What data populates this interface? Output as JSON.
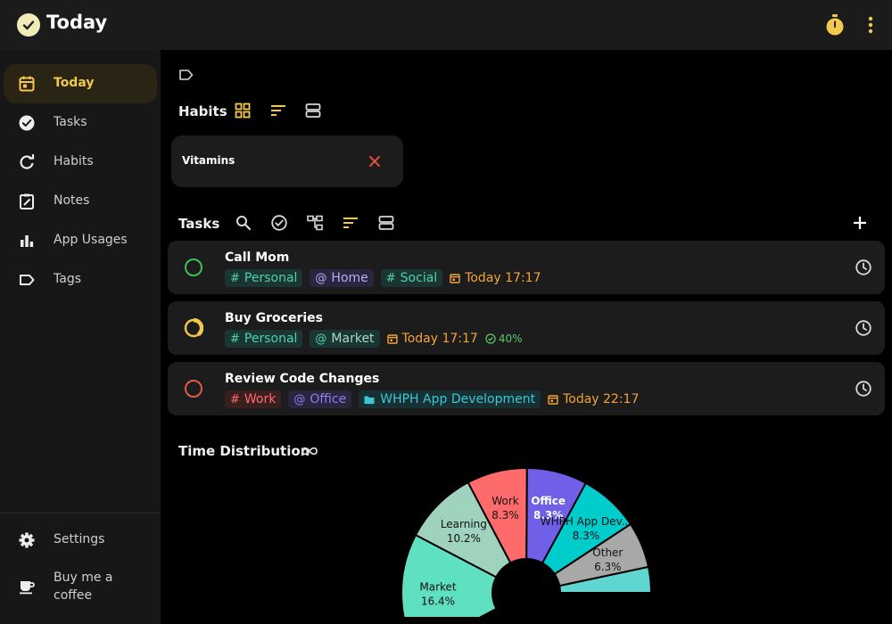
{
  "header": {
    "title": "Today",
    "app_icon": "check-circle-icon",
    "timer_icon": "stopwatch-icon",
    "menu_icon": "more-vert-icon"
  },
  "sidebar": {
    "items": [
      {
        "label": "Today",
        "icon": "calendar-icon",
        "active": true
      },
      {
        "label": "Tasks",
        "icon": "check-circle-icon"
      },
      {
        "label": "Habits",
        "icon": "refresh-icon"
      },
      {
        "label": "Notes",
        "icon": "note-edit-icon"
      },
      {
        "label": "App Usages",
        "icon": "bar-chart-icon"
      },
      {
        "label": "Tags",
        "icon": "label-icon"
      }
    ],
    "bottom": [
      {
        "label": "Settings",
        "icon": "gear-icon"
      },
      {
        "label": "Buy me a coffee",
        "icon": "coffee-cup-icon"
      }
    ]
  },
  "habits": {
    "title": "Habits",
    "items": [
      {
        "name": "Vitamins"
      }
    ]
  },
  "tasks": {
    "title": "Tasks",
    "items": [
      {
        "title": "Call Mom",
        "status": "empty",
        "status_color": "#3fbf5a",
        "chips": [
          {
            "prefix": "#",
            "text": "Personal",
            "style": "teal"
          },
          {
            "prefix": "@",
            "text": "Home",
            "style": "purple"
          },
          {
            "prefix": "#",
            "text": "Social",
            "style": "teal"
          }
        ],
        "date": "Today 17:17"
      },
      {
        "title": "Buy Groceries",
        "status": "in-progress",
        "status_color": "#f2c94c",
        "progress_fraction": 0.4,
        "chips": [
          {
            "prefix": "#",
            "text": "Personal",
            "style": "teal"
          },
          {
            "prefix": "@",
            "text": "Market",
            "style": "teal"
          }
        ],
        "date": "Today 17:17",
        "progress": "40%"
      },
      {
        "title": "Review Code Changes",
        "status": "empty",
        "status_color": "#e05a4f",
        "chips": [
          {
            "prefix": "#",
            "text": "Work",
            "style": "red"
          },
          {
            "prefix": "@",
            "text": "Office",
            "style": "purple"
          },
          {
            "prefix": "folder",
            "text": "WHPH App Development",
            "style": "cyan"
          }
        ],
        "date": "Today 22:17"
      }
    ]
  },
  "time_distribution": {
    "title": "Time Distribution",
    "icon": "infinity-icon"
  },
  "chart_data": {
    "type": "pie",
    "variant": "donut",
    "slices": [
      {
        "label": "Market",
        "value": 16.4,
        "value_label": "16.4%",
        "color": "#5fe0c0"
      },
      {
        "label": "Learning",
        "value": 10.2,
        "value_label": "10.2%",
        "color": "#9fd3bd"
      },
      {
        "label": "Work",
        "value": 8.3,
        "value_label": "8.3%",
        "color": "#ff6b6b"
      },
      {
        "label": "Office",
        "value": 8.3,
        "value_label": "8.3%",
        "color": "#7060e8"
      },
      {
        "label": "WHPH App Dev...",
        "value": 8.3,
        "value_label": "8.3%",
        "color": "#00cccc"
      },
      {
        "label": "Other",
        "value": 6.3,
        "value_label": "6.3%",
        "color": "#a8a8a8"
      }
    ]
  }
}
